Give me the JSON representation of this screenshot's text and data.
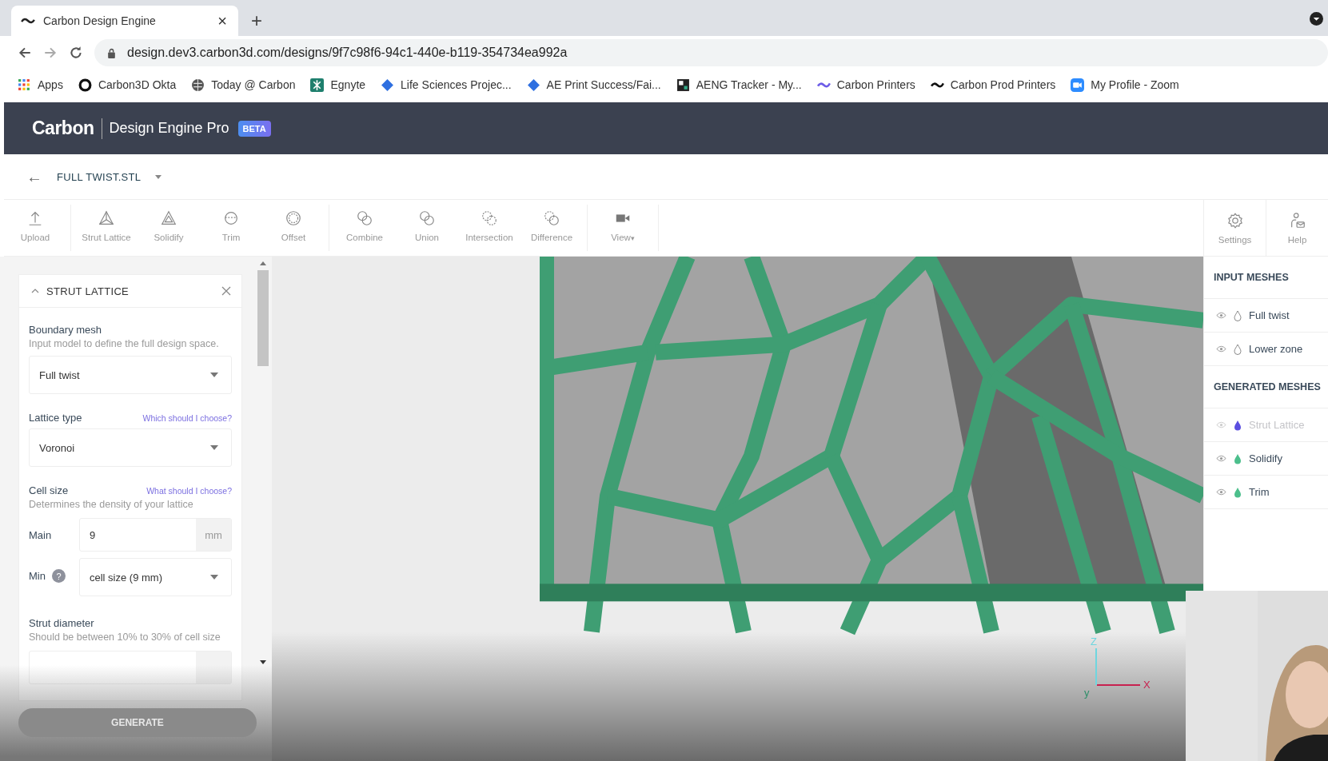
{
  "browser": {
    "tab": {
      "title": "Carbon Design Engine",
      "close": "×"
    },
    "new_tab": "+",
    "url": "design.dev3.carbon3d.com/designs/9f7c98f6-94c1-440e-b119-354734ea992a",
    "bookmarks": [
      {
        "label": "Apps",
        "kind": "apps"
      },
      {
        "label": "Carbon3D Okta",
        "kind": "ring"
      },
      {
        "label": "Today @ Carbon",
        "kind": "globe"
      },
      {
        "label": "Egnyte",
        "kind": "egnyte"
      },
      {
        "label": "Life Sciences Projec...",
        "kind": "diamond"
      },
      {
        "label": "AE Print Success/Fai...",
        "kind": "diamond"
      },
      {
        "label": "AENG Tracker - My...",
        "kind": "tracker"
      },
      {
        "label": "Carbon Printers",
        "kind": "wave-purple"
      },
      {
        "label": "Carbon Prod Printers",
        "kind": "wave-dark"
      },
      {
        "label": "My Profile - Zoom",
        "kind": "camera"
      }
    ]
  },
  "app": {
    "brand": "Carbon",
    "product": "Design Engine Pro",
    "badge": "BETA"
  },
  "file": {
    "back": "←",
    "name": "FULL TWIST.STL"
  },
  "toolbar": [
    [
      {
        "label": "Upload",
        "kind": "upload"
      }
    ],
    [
      {
        "label": "Strut Lattice",
        "kind": "strut"
      },
      {
        "label": "Solidify",
        "kind": "solidify"
      },
      {
        "label": "Trim",
        "kind": "trim"
      },
      {
        "label": "Offset",
        "kind": "offset"
      }
    ],
    [
      {
        "label": "Combine",
        "kind": "combine"
      },
      {
        "label": "Union",
        "kind": "union"
      },
      {
        "label": "Intersection",
        "kind": "intersection"
      },
      {
        "label": "Difference",
        "kind": "difference"
      }
    ],
    [
      {
        "label": "View",
        "kind": "view",
        "menu": "▾"
      }
    ]
  ],
  "toolbar_right": [
    {
      "label": "Settings",
      "kind": "gear"
    },
    {
      "label": "Help",
      "kind": "help"
    }
  ],
  "panel": {
    "title": "STRUT LATTICE",
    "expanded": true,
    "boundary": {
      "label": "Boundary mesh",
      "hint": "Input model to define the full design space.",
      "value": "Full twist"
    },
    "lattice": {
      "label": "Lattice type",
      "link": "Which should I choose?",
      "value": "Voronoi"
    },
    "cell": {
      "label": "Cell size",
      "link": "What should I choose?",
      "hint": "Determines the density of your lattice",
      "main_label": "Main",
      "main_value": "9",
      "unit": "mm",
      "min_label": "Min",
      "help": "?",
      "min_value": "cell size (9 mm)"
    },
    "strut": {
      "label": "Strut diameter",
      "hint": "Should be between 10% to 30% of cell size"
    },
    "generate": {
      "label": "GENERATE",
      "disabled": true
    }
  },
  "viewport": {
    "kind": "picture",
    "axes": {
      "z": "Z",
      "y": "y",
      "x": "X"
    }
  },
  "meshes": [
    {
      "heading": "INPUT MESHES",
      "items": [
        {
          "name": "Full twist",
          "disabled": false
        },
        {
          "name": "Lower zone",
          "disabled": false
        }
      ]
    },
    {
      "heading": "GENERATED MESHES",
      "items": [
        {
          "name": "Strut Lattice",
          "disabled": true,
          "color": "#5b4fe0"
        },
        {
          "name": "Solidify",
          "disabled": false,
          "color": "#4cbf8c"
        },
        {
          "name": "Trim",
          "disabled": false,
          "color": "#4cbf8c"
        }
      ]
    }
  ],
  "webcam": {
    "kind": "picture"
  }
}
